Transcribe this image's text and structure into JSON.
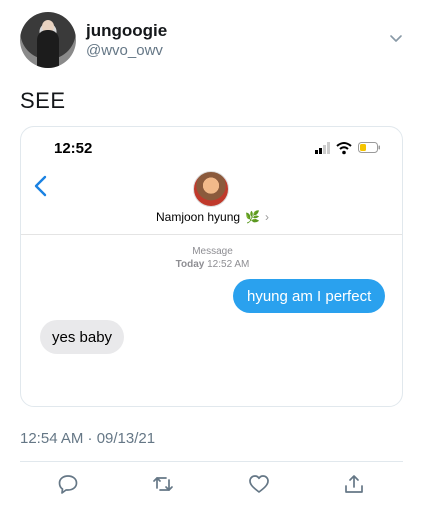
{
  "tweet": {
    "display_name": "jungoogie",
    "handle": "@wvo_owv",
    "text": "SEE",
    "timestamp": "12:54 AM · 09/13/21"
  },
  "media": {
    "status_time": "12:52",
    "contact_name": "Namjoon hyung",
    "contact_emoji": "🌿",
    "contact_chevron": "›",
    "label_service": "Message",
    "label_day": "Today",
    "label_time": "12:52 AM",
    "messages": [
      {
        "direction": "outgoing",
        "text": "hyung am I perfect"
      },
      {
        "direction": "incoming",
        "text": "yes baby"
      }
    ]
  },
  "icons": {
    "more": "chevron-down-icon",
    "back": "chevron-left-icon",
    "reply": "reply-icon",
    "retweet": "retweet-icon",
    "like": "heart-icon",
    "share": "share-icon"
  },
  "colors": {
    "accent": "#1da1f2",
    "outgoing_bubble": "#2aa1ee",
    "incoming_bubble": "#e9e9eb",
    "secondary_text": "#657786"
  }
}
